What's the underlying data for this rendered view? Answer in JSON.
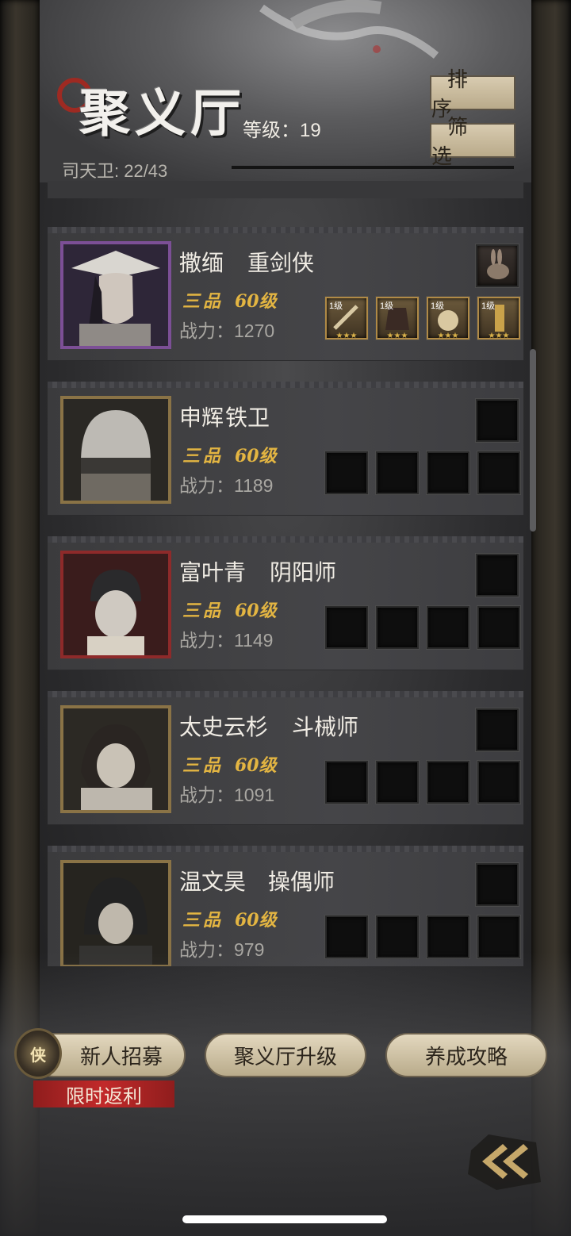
{
  "header": {
    "title": "聚义厅",
    "level_label": "等级：19",
    "guard_count": "司天卫: 22/43",
    "sort_label": "排序",
    "filter_label": "筛选"
  },
  "heroes": [
    {
      "name": "撒缅",
      "class": "重剑侠",
      "rank": "三品",
      "level": "60级",
      "power": "战力：1270",
      "frame": "purple",
      "pet_icon": "rabbit-icon",
      "gear": [
        {
          "level": "1级",
          "stars": "★★★",
          "icon": "sword-icon"
        },
        {
          "level": "1级",
          "stars": "★★★",
          "icon": "armor-icon"
        },
        {
          "level": "1级",
          "stars": "★★★",
          "icon": "pouch-icon"
        },
        {
          "level": "1级",
          "stars": "★★★",
          "icon": "scroll-icon"
        }
      ]
    },
    {
      "name": "申辉",
      "class": "铁卫",
      "rank": "三品",
      "level": "60级",
      "power": "战力：1189",
      "frame": "gold"
    },
    {
      "name": "富叶青",
      "class": "阴阳师",
      "rank": "三品",
      "level": "60级",
      "power": "战力：1149",
      "frame": "red"
    },
    {
      "name": "太史云杉",
      "class": "斗械师",
      "rank": "三品",
      "level": "60级",
      "power": "战力：1091",
      "frame": "gold"
    },
    {
      "name": "温文昊",
      "class": "操偶师",
      "rank": "三品",
      "level": "60级",
      "power": "战力：979",
      "frame": "gold"
    }
  ],
  "bottom": {
    "recruit_label": "新人招募",
    "recruit_medal": "侠",
    "promo_label": "限时返利",
    "upgrade_label": "聚义厅升级",
    "guide_label": "养成攻略"
  },
  "colors": {
    "rank_gold": "#e3b542",
    "promo_red": "#c22a2a",
    "frame_purple": "#7c4f96",
    "frame_gold": "#8a7346",
    "frame_red": "#8e2a2a"
  }
}
